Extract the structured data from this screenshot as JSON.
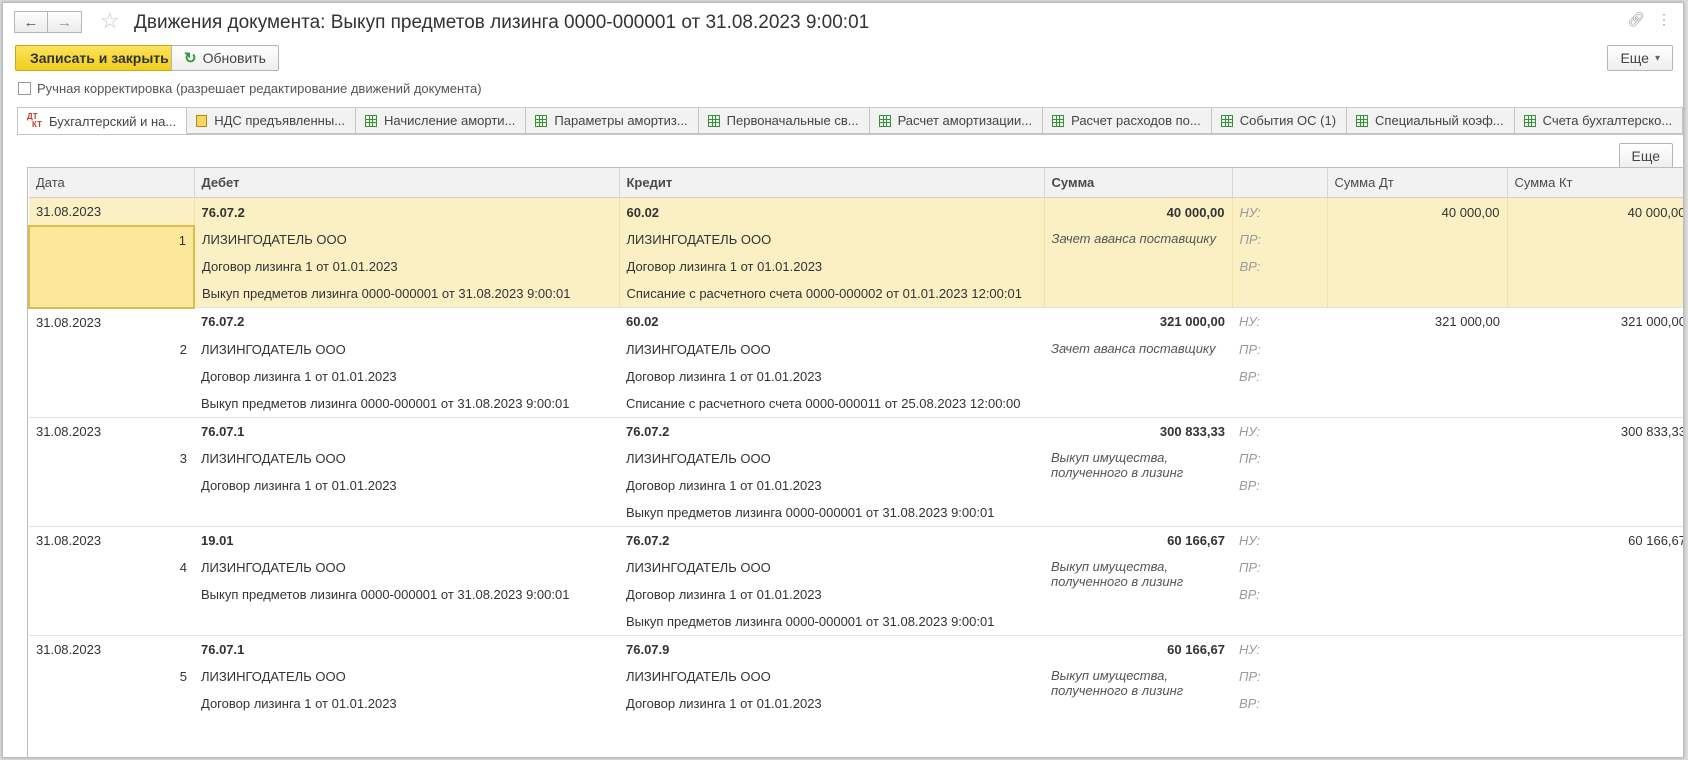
{
  "window": {
    "title": "Движения документа: Выкуп предметов лизинга 0000-000001 от 31.08.2023 9:00:01"
  },
  "toolbar": {
    "save_close": "Записать и закрыть",
    "refresh": "Обновить",
    "more": "Еще",
    "more_arrow": "▾"
  },
  "manual_edit": {
    "label": "Ручная корректировка (разрешает редактирование движений документа)"
  },
  "tabs": [
    {
      "label": "Бухгалтерский и на..."
    },
    {
      "label": "НДС предъявленны..."
    },
    {
      "label": "Начисление аморти..."
    },
    {
      "label": "Параметры амортиз..."
    },
    {
      "label": "Первоначальные св..."
    },
    {
      "label": "Расчет амортизации..."
    },
    {
      "label": "Расчет расходов по..."
    },
    {
      "label": "События ОС (1)"
    },
    {
      "label": "Специальный коэф..."
    },
    {
      "label": "Счета бухгалтерско..."
    }
  ],
  "grid_toolbar": {
    "more": "Еще"
  },
  "table": {
    "columns": {
      "date": "Дата",
      "debit": "Дебет",
      "credit": "Кредит",
      "sum": "Сумма",
      "sum_dt": "Сумма Дт",
      "sum_kt": "Сумма Кт"
    },
    "tags": {
      "nu": "НУ:",
      "pr": "ПР:",
      "vr": "ВР:"
    },
    "rows": [
      {
        "date": "31.08.2023",
        "num": "1",
        "debit": {
          "account": "76.07.2",
          "sub": [
            "ЛИЗИНГОДАТЕЛЬ ООО",
            "Договор лизинга 1 от 01.01.2023",
            "Выкуп предметов лизинга 0000-000001 от 31.08.2023 9:00:01"
          ]
        },
        "credit": {
          "account": "60.02",
          "sub": [
            "ЛИЗИНГОДАТЕЛЬ ООО",
            "Договор лизинга 1 от 01.01.2023",
            "Списание с расчетного счета 0000-000002 от 01.01.2023 12:00:01"
          ]
        },
        "sum": "40 000,00",
        "content": "Зачет аванса поставщику",
        "sum_dt": "40 000,00",
        "sum_kt": "40 000,00"
      },
      {
        "date": "31.08.2023",
        "num": "2",
        "debit": {
          "account": "76.07.2",
          "sub": [
            "ЛИЗИНГОДАТЕЛЬ ООО",
            "Договор лизинга 1 от 01.01.2023",
            "Выкуп предметов лизинга 0000-000001 от 31.08.2023 9:00:01"
          ]
        },
        "credit": {
          "account": "60.02",
          "sub": [
            "ЛИЗИНГОДАТЕЛЬ ООО",
            "Договор лизинга 1 от 01.01.2023",
            "Списание с расчетного счета 0000-000011 от 25.08.2023 12:00:00"
          ]
        },
        "sum": "321 000,00",
        "content": "Зачет аванса поставщику",
        "sum_dt": "321 000,00",
        "sum_kt": "321 000,00"
      },
      {
        "date": "31.08.2023",
        "num": "3",
        "debit": {
          "account": "76.07.1",
          "sub": [
            "ЛИЗИНГОДАТЕЛЬ ООО",
            "Договор лизинга 1 от 01.01.2023",
            ""
          ]
        },
        "credit": {
          "account": "76.07.2",
          "sub": [
            "ЛИЗИНГОДАТЕЛЬ ООО",
            "Договор лизинга 1 от 01.01.2023",
            "Выкуп предметов лизинга 0000-000001 от 31.08.2023 9:00:01"
          ]
        },
        "sum": "300 833,33",
        "content": "Выкуп имущества, полученного в лизинг",
        "sum_dt": "",
        "sum_kt": "300 833,33"
      },
      {
        "date": "31.08.2023",
        "num": "4",
        "debit": {
          "account": "19.01",
          "sub": [
            "ЛИЗИНГОДАТЕЛЬ ООО",
            "Выкуп предметов лизинга 0000-000001 от 31.08.2023 9:00:01",
            ""
          ]
        },
        "credit": {
          "account": "76.07.2",
          "sub": [
            "ЛИЗИНГОДАТЕЛЬ ООО",
            "Договор лизинга 1 от 01.01.2023",
            "Выкуп предметов лизинга 0000-000001 от 31.08.2023 9:00:01"
          ]
        },
        "sum": "60 166,67",
        "content": "Выкуп имущества, полученного в лизинг",
        "sum_dt": "",
        "sum_kt": "60 166,67"
      },
      {
        "date": "31.08.2023",
        "num": "5",
        "debit": {
          "account": "76.07.1",
          "sub": [
            "ЛИЗИНГОДАТЕЛЬ ООО",
            "Договор лизинга 1 от 01.01.2023",
            ""
          ]
        },
        "credit": {
          "account": "76.07.9",
          "sub": [
            "ЛИЗИНГОДАТЕЛЬ ООО",
            "Договор лизинга 1 от 01.01.2023",
            ""
          ]
        },
        "sum": "60 166,67",
        "content": "Выкуп имущества, полученного в лизинг",
        "sum_dt": "",
        "sum_kt": ""
      }
    ]
  },
  "colors": {
    "primary_button": "#f1cd1c",
    "selected_row": "#fbf0c4",
    "selected_cell": "#fbe89a",
    "tag_text": "#9a9a9a"
  }
}
